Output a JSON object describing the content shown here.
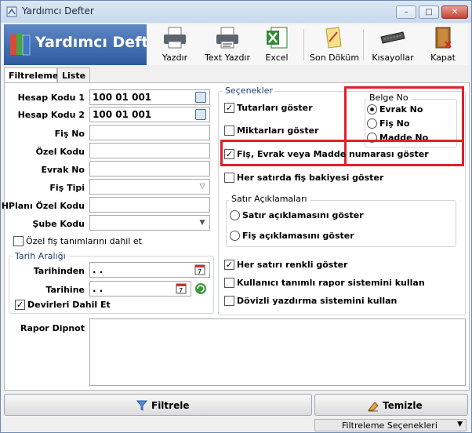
{
  "window": {
    "title": "Yardımcı Defter",
    "minimize": "–",
    "maximize": "□",
    "close": "✕"
  },
  "brand": {
    "label": "Yardımcı Defte"
  },
  "toolbar": {
    "buttons": [
      {
        "label": "Yazdır",
        "icon": "printer-icon"
      },
      {
        "label": "Text Yazdır",
        "icon": "printer-text-icon"
      },
      {
        "label": "Excel",
        "icon": "excel-icon"
      },
      {
        "label": "Son Döküm",
        "icon": "document-icon"
      },
      {
        "label": "Kısayollar",
        "icon": "keyboard-icon"
      },
      {
        "label": "Kapat",
        "icon": "exit-icon"
      }
    ]
  },
  "tabs": [
    {
      "label": "Filtreleme",
      "active": true
    },
    {
      "label": "Liste",
      "active": false
    }
  ],
  "filters": {
    "hesap_kodu_1": {
      "label": "Hesap Kodu 1",
      "value": "100 01 001"
    },
    "hesap_kodu_2": {
      "label": "Hesap Kodu 2",
      "value": "100 01 001"
    },
    "fis_no": {
      "label": "Fiş No",
      "value": ""
    },
    "ozel_kodu": {
      "label": "Özel Kodu",
      "value": ""
    },
    "evrak_no": {
      "label": "Evrak No",
      "value": ""
    },
    "fis_tipi": {
      "label": "Fiş Tipi",
      "value": ""
    },
    "hplani_ozel_kodu": {
      "label": "HPlanı Özel Kodu",
      "value": ""
    },
    "sube_kodu": {
      "label": "Şube Kodu",
      "value": ""
    },
    "ozel_fis": {
      "label": "Özel fiş tanımlarını dahil et",
      "checked": false
    }
  },
  "tarih": {
    "title": "Tarih Aralığı",
    "tarihinden": {
      "label": "Tarihinden",
      "value": ". ."
    },
    "tarihine": {
      "label": "Tarihine",
      "value": ". ."
    },
    "devirler": {
      "label": "Devirleri Dahil Et",
      "checked": true
    }
  },
  "secenekler": {
    "title": "Seçenekler",
    "tutarlari": {
      "label": "Tutarları göster",
      "checked": true
    },
    "miktarlari": {
      "label": "Miktarları göster",
      "checked": false
    },
    "fis_evrak": {
      "label": "Fiş, Evrak veya Madde numarası göster",
      "checked": true
    },
    "bakiye": {
      "label": "Her satırda fiş bakiyesi göster",
      "checked": false
    },
    "renkli": {
      "label": "Her satırı renkli göster",
      "checked": true
    },
    "kullanici": {
      "label": "Kullanıcı tanımlı rapor sistemini kullan",
      "checked": false
    },
    "dovizli": {
      "label": "Dövizli yazdırma sistemini kullan",
      "checked": false
    }
  },
  "belge_no": {
    "title": "Belge No",
    "options": [
      {
        "label": "Evrak No",
        "selected": true
      },
      {
        "label": "Fiş No",
        "selected": false
      },
      {
        "label": "Madde No",
        "selected": false
      }
    ]
  },
  "satir": {
    "title": "Satır Açıklamaları",
    "options": [
      {
        "label": "Satır açıklamasını göster",
        "selected": false
      },
      {
        "label": "Fiş açıklamasını göster",
        "selected": false
      }
    ]
  },
  "rapor_dipnot": {
    "label": "Rapor Dipnot",
    "value": ""
  },
  "actions": {
    "filtrele": "Filtrele",
    "temizle": "Temizle"
  },
  "status": {
    "label": "Filtreleme Seçenekleri",
    "arrow": "▼"
  },
  "colors": {
    "highlight_border": "#e0202a",
    "brand_bg": "#2d5b9f"
  }
}
